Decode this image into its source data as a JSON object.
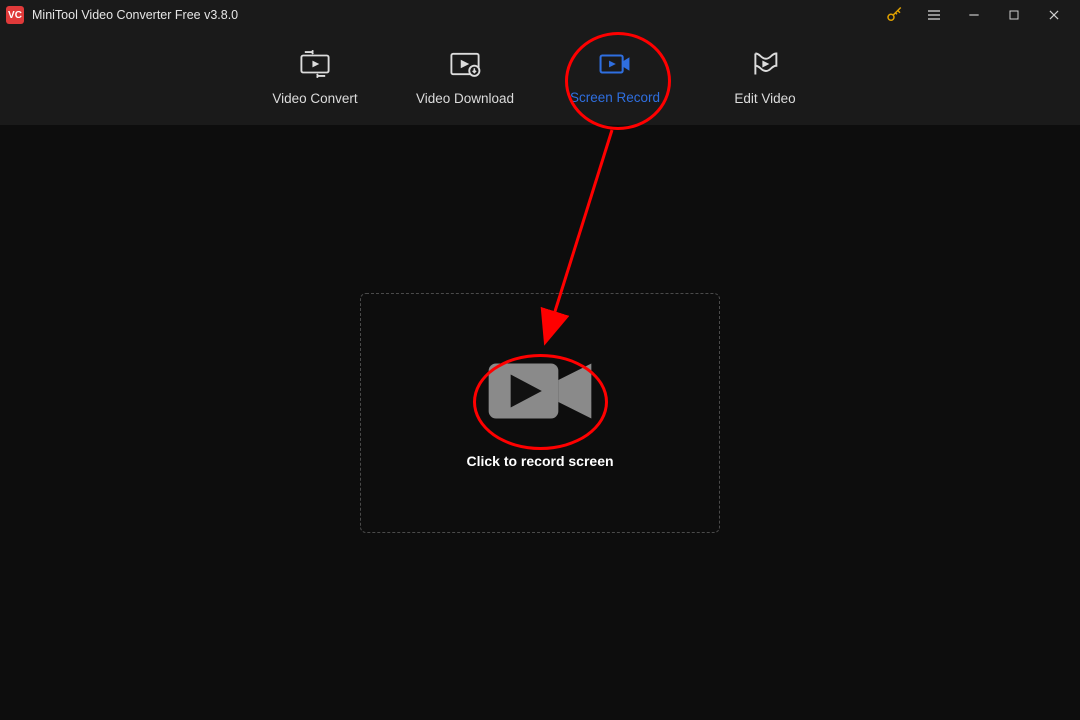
{
  "app": {
    "title": "MiniTool Video Converter Free v3.8.0",
    "logo_text": "VC"
  },
  "tabs": {
    "convert": "Video Convert",
    "download": "Video Download",
    "record": "Screen Record",
    "edit": "Edit Video"
  },
  "main": {
    "record_cta": "Click to record screen"
  }
}
